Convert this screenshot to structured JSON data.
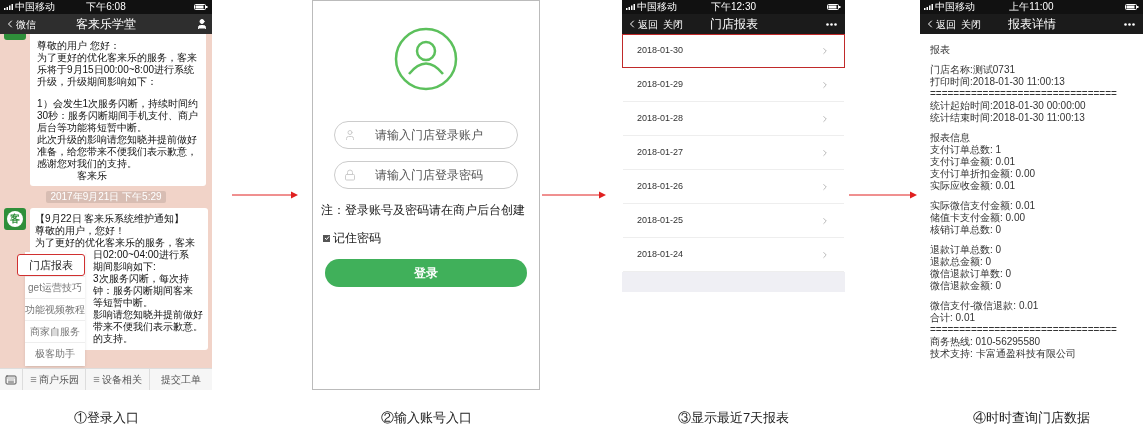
{
  "chat_screen": {
    "caption": "①登录入口",
    "status": {
      "carrier": "中国移动",
      "time": "下午6:08"
    },
    "nav": {
      "back": "微信",
      "title": "客来乐学堂"
    },
    "first_message": {
      "groups": [
        [
          "尊敬的用户  您好：",
          "为了更好的优化客来乐的服务，客来乐将于9月15日00:00~8:00进行系统升级，升级期间影响如下："
        ],
        [
          "1）会发生1次服务闪断，持续时间约30秒：服务闪断期间手机支付、商户后台等功能将短暂中断。",
          "此次升级的影响请您知晓并提前做好准备，给您带来不便我们表示歉意，感谢您对我们的支持。"
        ]
      ],
      "signature": "客来乐"
    },
    "timestamp": "2017年9月21日 下午5:29",
    "second_message": {
      "avatar_text": "客",
      "lines": [
        "【9月22日 客来乐系统维护通知】",
        "尊敬的用户，您好！",
        "为了更好的优化客来乐的服务，客来"
      ],
      "covered_lines": [
        "日02:00~04:00进行系",
        "期间影响如下:",
        "3次服务闪断，每次持",
        "钟：服务闪断期间客来",
        "等短暂中断。",
        "影响请您知晓并提前做好",
        "带来不便我们表示歉意。",
        "的支持。"
      ]
    },
    "menu": {
      "items": [
        {
          "label": "门店报表",
          "selected": true
        },
        {
          "label": "get运营技巧",
          "selected": false
        },
        {
          "label": "功能视频教程",
          "selected": false
        },
        {
          "label": "商家自服务",
          "selected": false
        },
        {
          "label": "极客助手",
          "selected": false
        }
      ]
    },
    "bottom_bar": [
      {
        "label": "商户乐园",
        "kind": "menu"
      },
      {
        "label": "设备相关",
        "kind": "menu"
      },
      {
        "label": "提交工单",
        "kind": "plain"
      }
    ]
  },
  "login_screen": {
    "caption": "②输入账号入口",
    "fields": [
      {
        "kind": "user",
        "placeholder": "请输入门店登录账户"
      },
      {
        "kind": "lock",
        "placeholder": "请输入门店登录密码"
      }
    ],
    "note": "注：登录账号及密码请在商户后台创建",
    "remember": {
      "label": "记住密码",
      "checked": true
    },
    "button": "登录"
  },
  "report_list_screen": {
    "caption": "③显示最近7天报表",
    "status": {
      "carrier": "中国移动",
      "time": "下午12:30"
    },
    "nav": {
      "back": "返回",
      "close": "关闭",
      "title": "门店报表"
    },
    "rows": [
      {
        "date": "2018-01-30",
        "selected": true
      },
      {
        "date": "2018-01-29",
        "selected": false
      },
      {
        "date": "2018-01-28",
        "selected": false
      },
      {
        "date": "2018-01-27",
        "selected": false
      },
      {
        "date": "2018-01-26",
        "selected": false
      },
      {
        "date": "2018-01-25",
        "selected": false
      },
      {
        "date": "2018-01-24",
        "selected": false
      }
    ]
  },
  "report_detail_screen": {
    "caption": "④时时查询门店数据",
    "status": {
      "carrier": "中国移动",
      "time": "上午11:00"
    },
    "nav": {
      "back": "返回",
      "close": "关闭",
      "title": "报表详情"
    },
    "sections": [
      [
        "报表"
      ],
      [
        "门店名称:测试0731",
        "打印时间:2018-01-30 11:00:13",
        "================================",
        "统计起始时间:2018-01-30 00:00:00",
        "统计结束时间:2018-01-30 11:00:13"
      ],
      [
        "报表信息",
        "支付订单总数: 1",
        "支付订单金额: 0.01",
        "支付订单折扣金额: 0.00",
        "实际应收金额: 0.01"
      ],
      [
        "实际微信支付金额: 0.01",
        "储值卡支付金额:  0.00",
        "核销订单总数: 0"
      ],
      [
        "退款订单总数: 0",
        "退款总金额: 0",
        "微信退款订单数: 0",
        "微信退款金额: 0"
      ],
      [
        "微信支付-微信退款: 0.01",
        "合计: 0.01",
        "================================",
        "商务热线:  010-56295580",
        "技术支持:  卡富通盈科技有限公司"
      ]
    ]
  }
}
